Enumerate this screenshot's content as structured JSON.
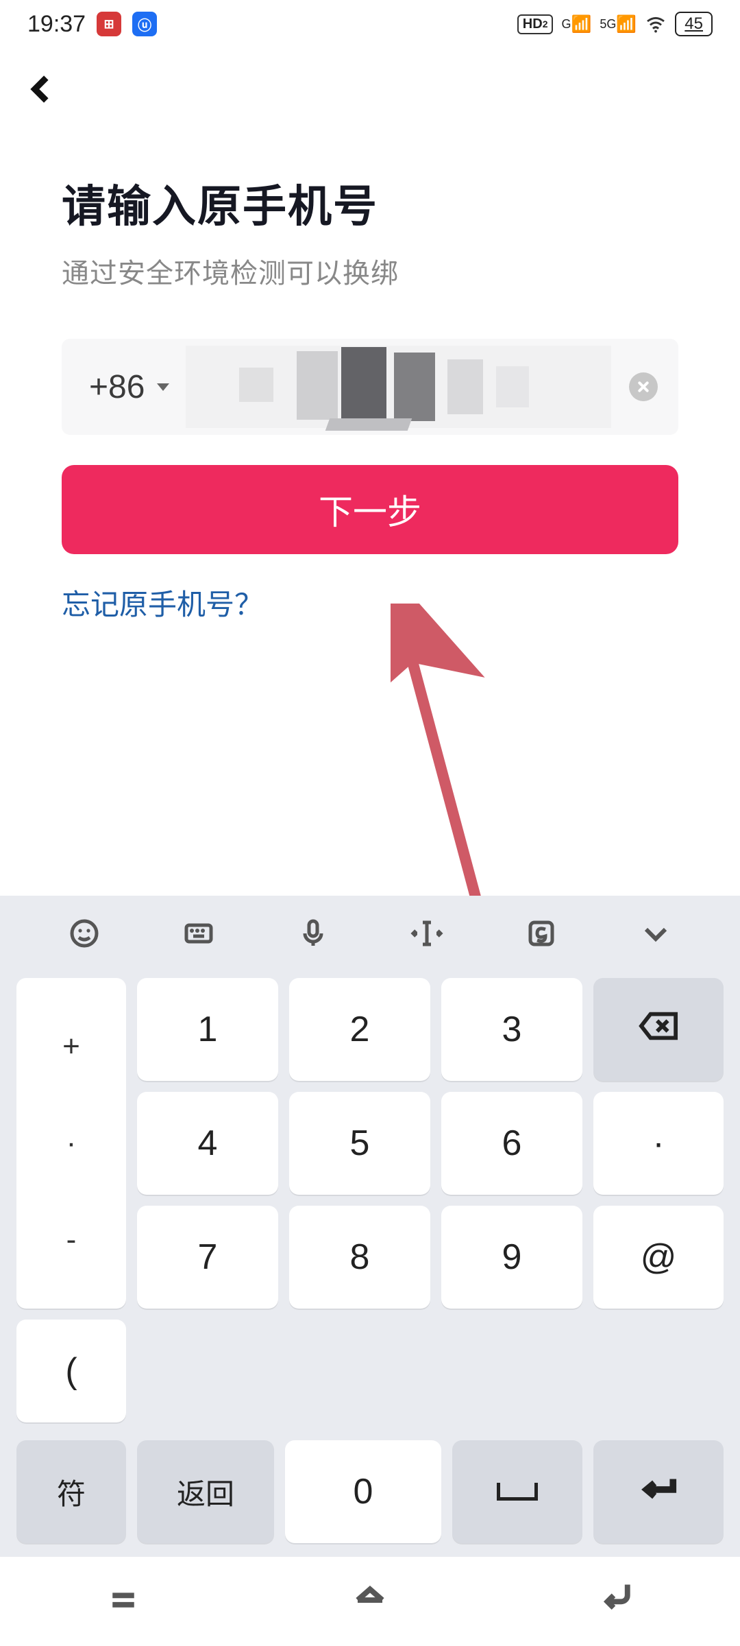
{
  "status": {
    "time": "19:37",
    "hd_label": "HD",
    "hd_sub": "2",
    "g_label": "G",
    "net_label": "5G",
    "battery": "45"
  },
  "page": {
    "title": "请输入原手机号",
    "subtitle": "通过安全环境检测可以换绑",
    "country_code": "+86",
    "next_button": "下一步",
    "forgot_link": "忘记原手机号？"
  },
  "keyboard": {
    "keys": {
      "plus": "+",
      "dot": "·",
      "minus": "-",
      "paren": "(",
      "k1": "1",
      "k2": "2",
      "k3": "3",
      "k4": "4",
      "k5": "5",
      "k6": "6",
      "k7": "7",
      "k8": "8",
      "k9": "9",
      "k0": "0",
      "middot": "·",
      "at": "@",
      "sym": "符",
      "back": "返回"
    }
  }
}
